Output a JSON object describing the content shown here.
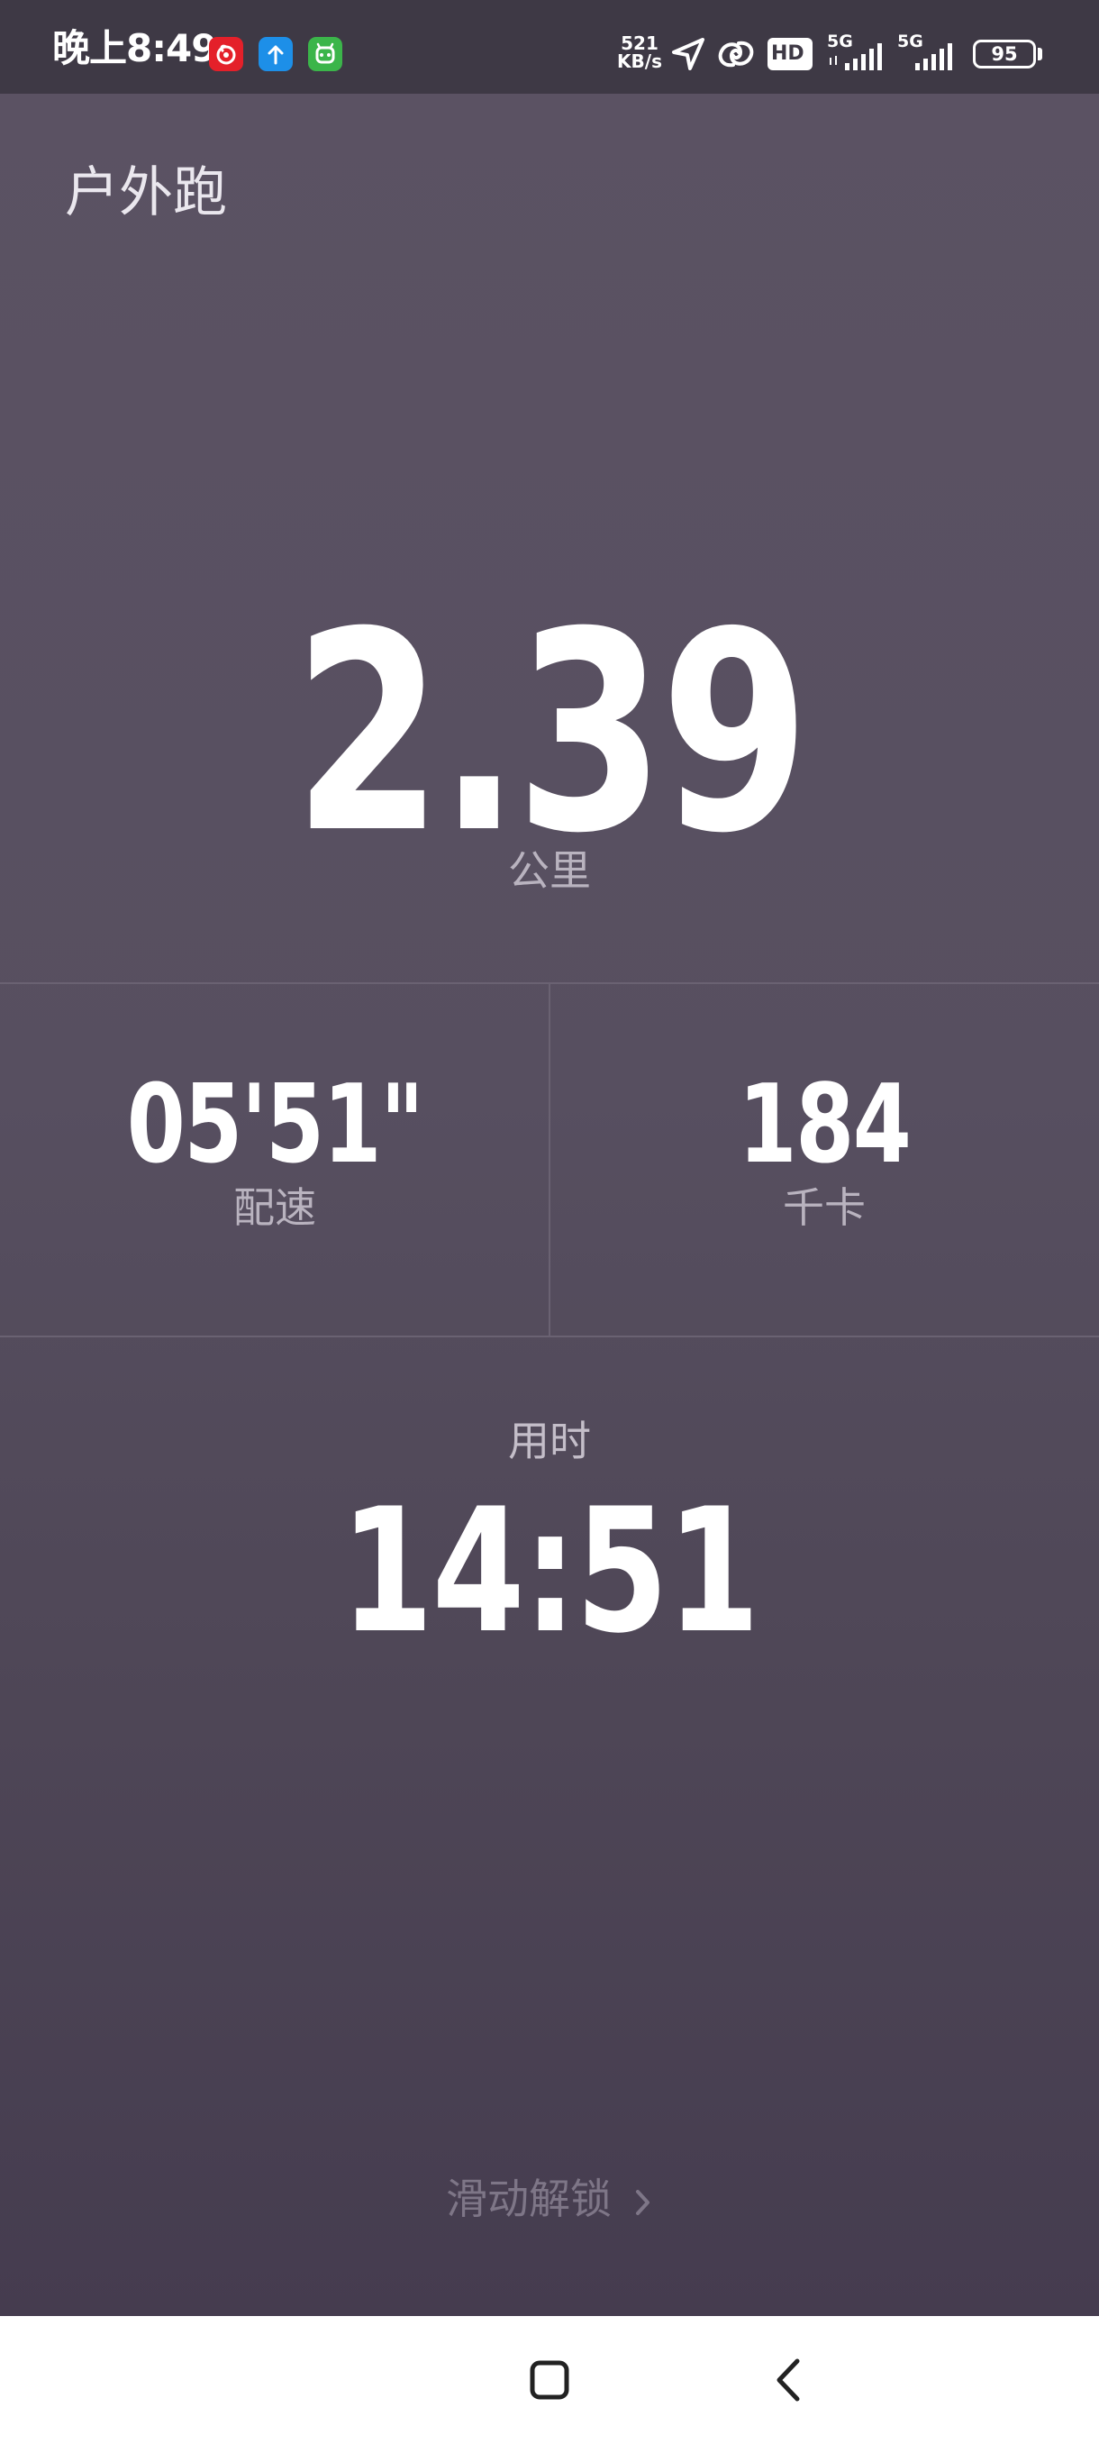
{
  "status_bar": {
    "time": "晚上8:49",
    "net_speed_value": "521",
    "net_speed_unit": "KB/s",
    "hd_label": "HD",
    "sim1_label": "5G",
    "sim2_label": "5G",
    "battery": "95",
    "app_icons": [
      "netease-music-icon",
      "upload-app-icon",
      "robot-app-icon"
    ]
  },
  "workout": {
    "title": "户外跑",
    "distance": "2.39",
    "distance_unit": "公里",
    "pace": "05'51\"",
    "pace_label": "配速",
    "calories": "184",
    "calories_label": "千卡",
    "duration_label": "用时",
    "duration": "14:51",
    "unlock_hint": "滑动解锁"
  },
  "colors": {
    "background_top": "#5b5263",
    "background_bottom": "#453c4f",
    "secondary_text": "#b9b3bf",
    "unlock_hint": "#7e7687",
    "status_bar": "#3e3945"
  }
}
